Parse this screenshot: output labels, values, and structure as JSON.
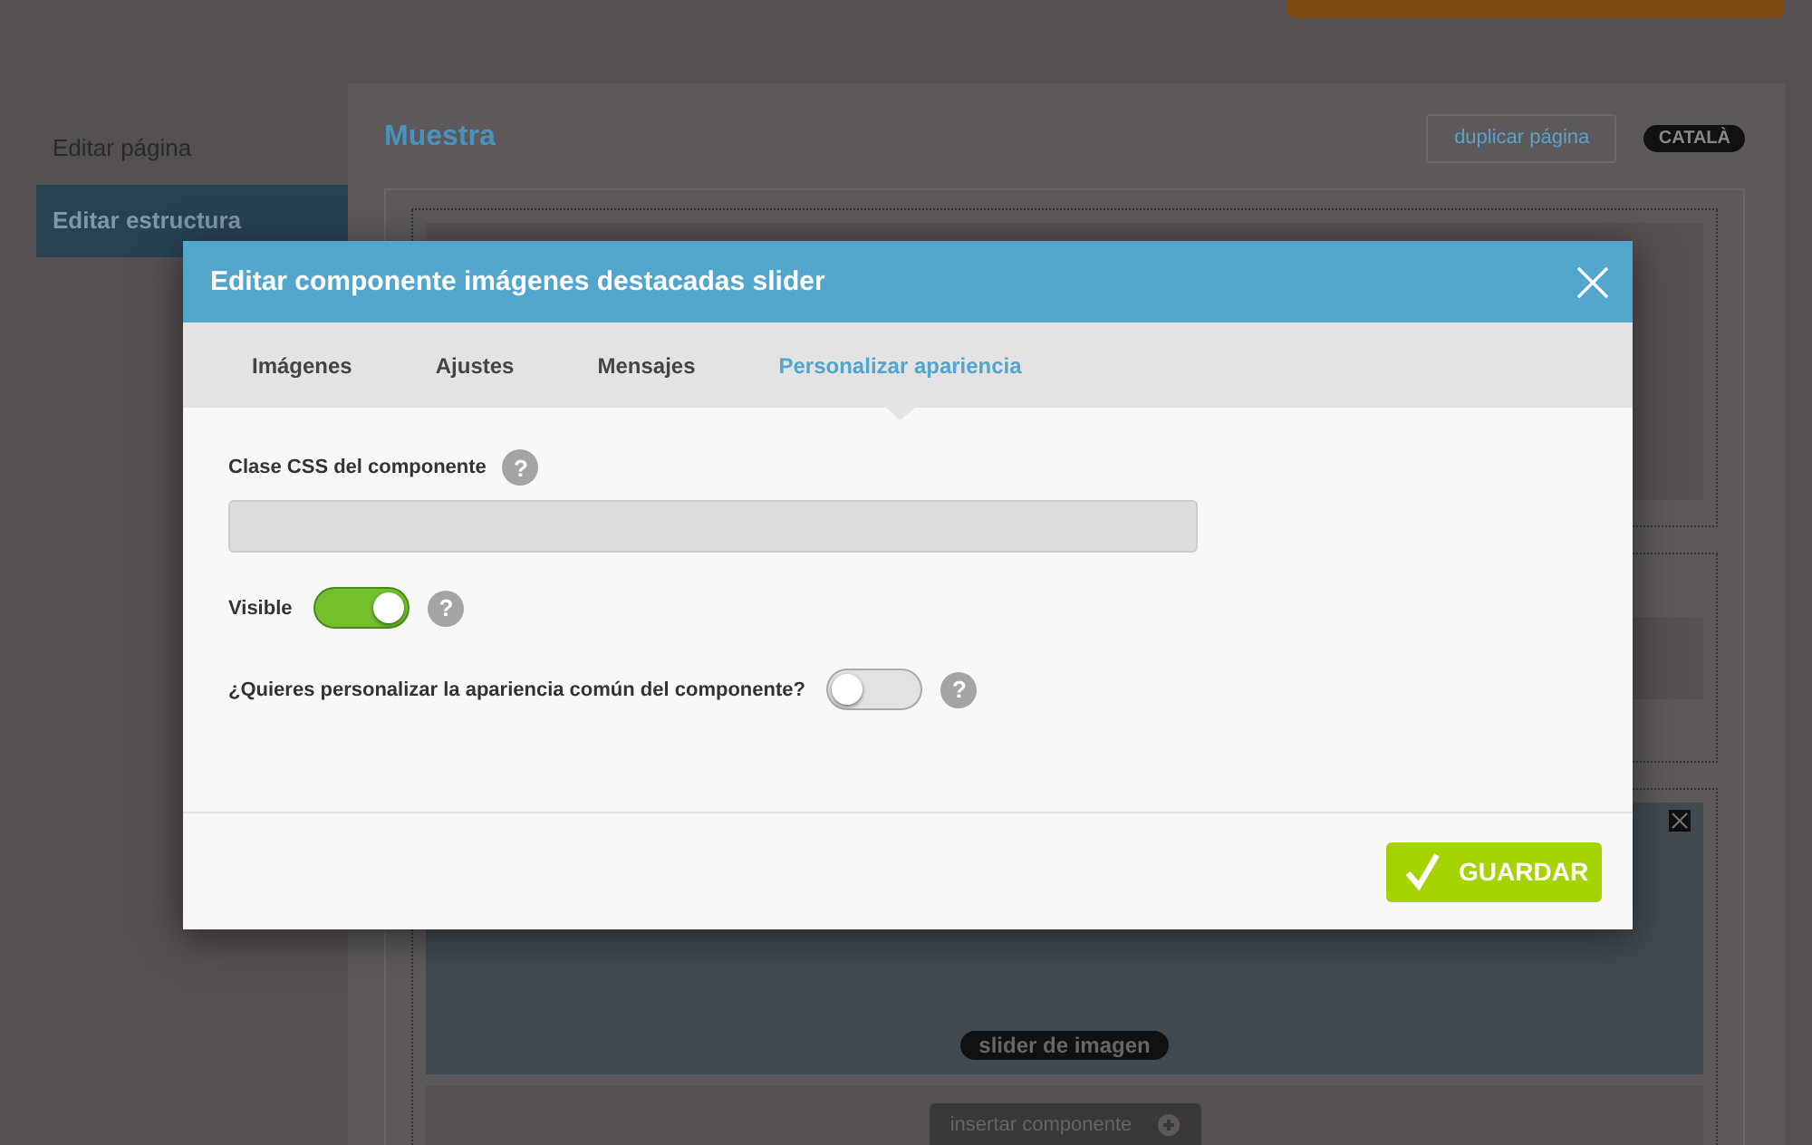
{
  "sidebar": {
    "items": [
      {
        "label": "Editar página",
        "selected": false
      },
      {
        "label": "Editar estructura",
        "selected": true
      }
    ]
  },
  "page": {
    "title": "Muestra",
    "duplicate_button": "duplicar página",
    "language_badge": "CATALÀ",
    "slider_label": "slider de imagen",
    "insert_button": "insertar componente"
  },
  "modal": {
    "title": "Editar componente imágenes destacadas slider",
    "tabs": [
      {
        "label": "Imágenes",
        "selected": false
      },
      {
        "label": "Ajustes",
        "selected": false
      },
      {
        "label": "Mensajes",
        "selected": false
      },
      {
        "label": "Personalizar apariencia",
        "selected": true
      }
    ],
    "fields": [
      {
        "kind": "text",
        "label": "Clase CSS del componente",
        "help": "?"
      },
      {
        "kind": "toggle",
        "label": "Visible",
        "on": true,
        "help": "?"
      },
      {
        "kind": "toggle",
        "label": "¿Quieres personalizar la apariencia común del componente?",
        "on": false,
        "help": "?"
      }
    ],
    "save_button": "GUARDAR"
  }
}
